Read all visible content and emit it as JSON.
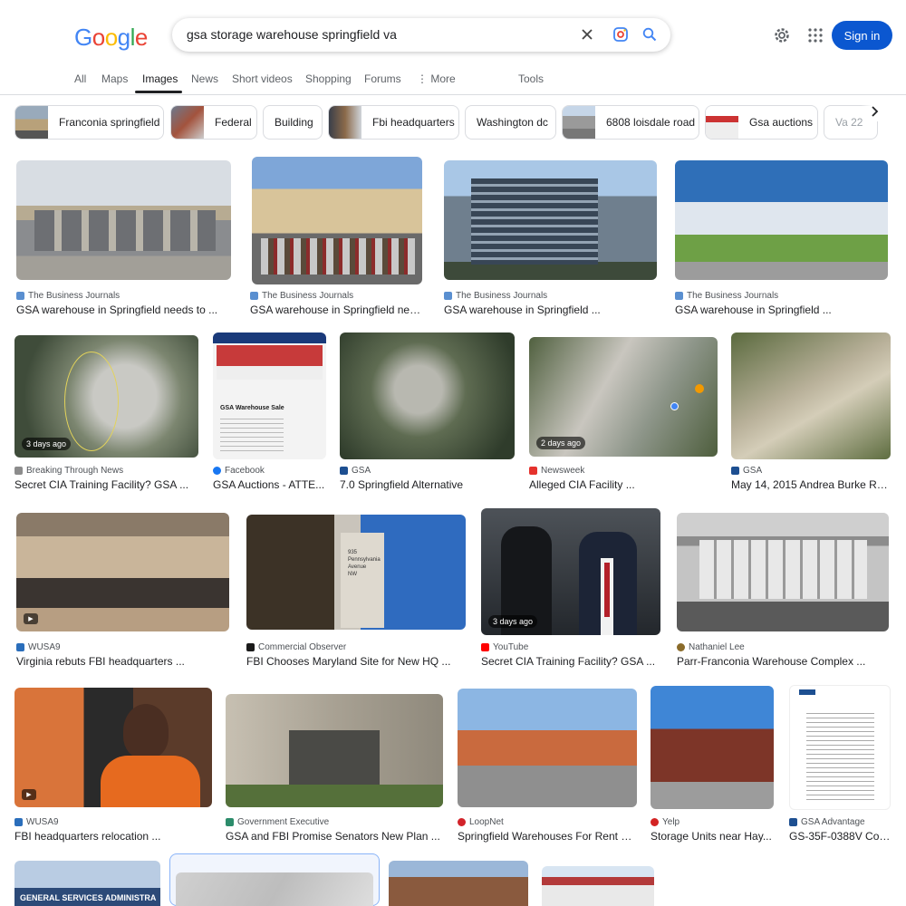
{
  "logo": "Google",
  "search": {
    "query": "gsa storage warehouse springfield va"
  },
  "header": {
    "signin_label": "Sign in"
  },
  "tabs": [
    {
      "label": "All"
    },
    {
      "label": "Maps"
    },
    {
      "label": "Images"
    },
    {
      "label": "News"
    },
    {
      "label": "Short videos"
    },
    {
      "label": "Shopping"
    },
    {
      "label": "Forums"
    },
    {
      "label": "More"
    }
  ],
  "tools_label": "Tools",
  "chips": [
    {
      "label": "Franconia springfield"
    },
    {
      "label": "Federal"
    },
    {
      "label": "Building"
    },
    {
      "label": "Fbi headquarters"
    },
    {
      "label": "Washington dc"
    },
    {
      "label": "6808 loisdale road"
    },
    {
      "label": "Gsa auctions"
    },
    {
      "label": "Va 22"
    }
  ],
  "results": [
    {
      "source": "The Business Journals",
      "title": "GSA warehouse in Springfield needs to ...",
      "badge": ""
    },
    {
      "source": "The Business Journals",
      "title": "GSA warehouse in Springfield needs ...",
      "badge": ""
    },
    {
      "source": "The Business Journals",
      "title": "GSA warehouse in Springfield ...",
      "badge": ""
    },
    {
      "source": "The Business Journals",
      "title": "GSA warehouse in Springfield ...",
      "badge": ""
    },
    {
      "source": "Breaking Through News",
      "title": "Secret CIA Training Facility? GSA ...",
      "badge": "3 days ago"
    },
    {
      "source": "Facebook",
      "title": "GSA Auctions - ATTE...",
      "badge": ""
    },
    {
      "source": "GSA",
      "title": "7.0 Springfield Alternative",
      "badge": ""
    },
    {
      "source": "Newsweek",
      "title": "Alleged CIA Facility ...",
      "badge": "2 days ago"
    },
    {
      "source": "GSA",
      "title": "May 14, 2015 Andrea Burke Revi...",
      "badge": ""
    },
    {
      "source": "WUSA9",
      "title": "Virginia rebuts FBI headquarters ...",
      "badge": ""
    },
    {
      "source": "Commercial Observer",
      "title": "FBI Chooses Maryland Site for New HQ ...",
      "badge": ""
    },
    {
      "source": "YouTube",
      "title": "Secret CIA Training Facility? GSA ...",
      "badge": "3 days ago"
    },
    {
      "source": "Nathaniel Lee",
      "title": "Parr-Franconia Warehouse Complex ...",
      "badge": ""
    },
    {
      "source": "WUSA9",
      "title": "FBI headquarters relocation ...",
      "badge": ""
    },
    {
      "source": "Government Executive",
      "title": "GSA and FBI Promise Senators New Plan ...",
      "badge": ""
    },
    {
      "source": "LoopNet",
      "title": "Springfield Warehouses For Rent & L...",
      "badge": ""
    },
    {
      "source": "Yelp",
      "title": "Storage Units near Hay...",
      "badge": ""
    },
    {
      "source": "GSA Advantage",
      "title": "GS-35F-0388V Cont...",
      "badge": ""
    }
  ],
  "image_texts": {
    "flyer_title": "GSA Warehouse Sale",
    "sign_line1": "935",
    "sign_line2": "Pennsylvania",
    "sign_line3": "Avenue",
    "sign_line4": "NW",
    "banner_text": "GENERAL SERVICES ADMINISTRA"
  },
  "colors": {
    "signin_bg": "#0b57d0",
    "active_tab": "#202124"
  }
}
